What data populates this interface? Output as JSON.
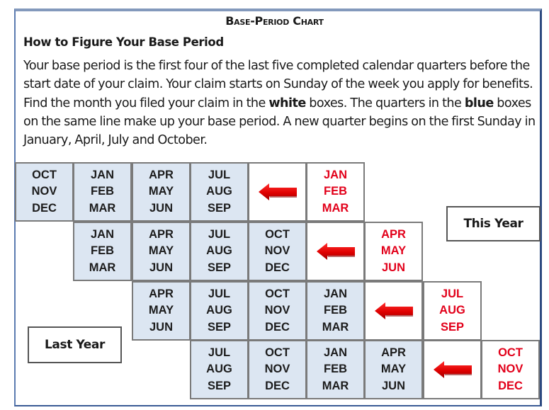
{
  "title": "Base-Period Chart",
  "subtitle": "How to Figure Your Base Period",
  "paragraph": {
    "part1": "Your base period is the first four of the last five completed calendar quarters before the start date of your claim. Your claim starts on Sunday of the week you apply for benefits. Find the month you filed your claim in the ",
    "bold1": "white",
    "part2": " boxes. The quarters in the ",
    "bold2": "blue",
    "part3": " boxes on the same line make up your base period. A new quarter begins on the first Sunday in January, April, July and October."
  },
  "labels": {
    "this_year": "This Year",
    "last_year": "Last Year"
  },
  "colors": {
    "base_quarter_fill": "#dce6f2",
    "claim_quarter_text": "#e2001a",
    "arrow": "#e00000"
  },
  "rows": [
    {
      "base_quarters": [
        [
          "OCT",
          "NOV",
          "DEC"
        ],
        [
          "JAN",
          "FEB",
          "MAR"
        ],
        [
          "APR",
          "MAY",
          "JUN"
        ],
        [
          "JUL",
          "AUG",
          "SEP"
        ]
      ],
      "arrow_icon": "left-arrow",
      "claim_quarter": [
        "JAN",
        "FEB",
        "MAR"
      ]
    },
    {
      "base_quarters": [
        [
          "JAN",
          "FEB",
          "MAR"
        ],
        [
          "APR",
          "MAY",
          "JUN"
        ],
        [
          "JUL",
          "AUG",
          "SEP"
        ],
        [
          "OCT",
          "NOV",
          "DEC"
        ]
      ],
      "arrow_icon": "left-arrow",
      "claim_quarter": [
        "APR",
        "MAY",
        "JUN"
      ]
    },
    {
      "base_quarters": [
        [
          "APR",
          "MAY",
          "JUN"
        ],
        [
          "JUL",
          "AUG",
          "SEP"
        ],
        [
          "OCT",
          "NOV",
          "DEC"
        ],
        [
          "JAN",
          "FEB",
          "MAR"
        ]
      ],
      "arrow_icon": "left-arrow",
      "claim_quarter": [
        "JUL",
        "AUG",
        "SEP"
      ]
    },
    {
      "base_quarters": [
        [
          "JUL",
          "AUG",
          "SEP"
        ],
        [
          "OCT",
          "NOV",
          "DEC"
        ],
        [
          "JAN",
          "FEB",
          "MAR"
        ],
        [
          "APR",
          "MAY",
          "JUN"
        ]
      ],
      "arrow_icon": "left-arrow",
      "claim_quarter": [
        "OCT",
        "NOV",
        "DEC"
      ]
    }
  ]
}
